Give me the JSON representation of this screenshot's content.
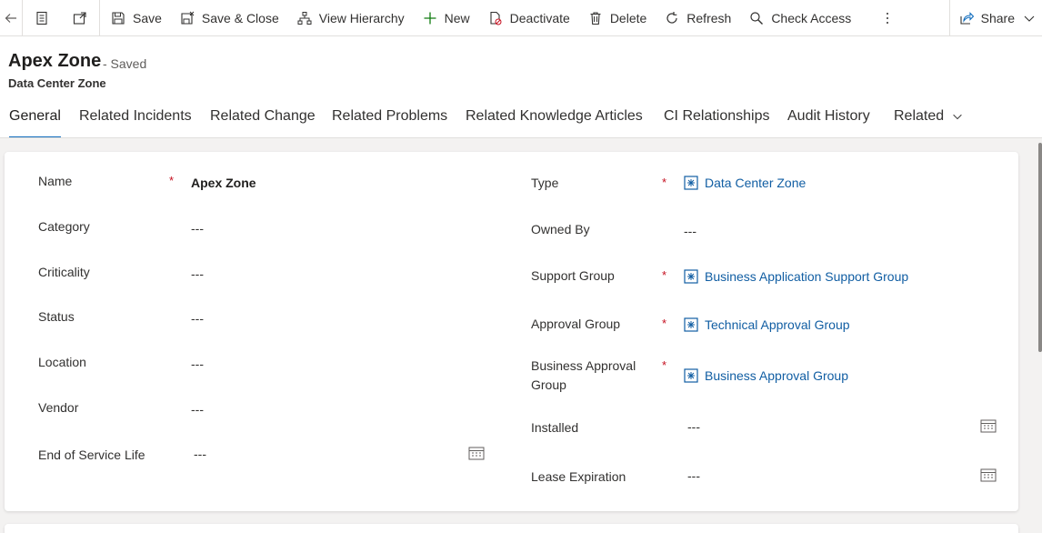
{
  "commands": {
    "save": "Save",
    "save_close": "Save & Close",
    "view_hierarchy": "View Hierarchy",
    "new": "New",
    "deactivate": "Deactivate",
    "delete": "Delete",
    "refresh": "Refresh",
    "check_access": "Check Access",
    "share": "Share"
  },
  "record": {
    "title": "Apex Zone",
    "status": "- Saved",
    "subtitle": "Data Center Zone"
  },
  "tabs": [
    {
      "label": "General",
      "active": true
    },
    {
      "label": "Related Incidents"
    },
    {
      "label": "Related Change"
    },
    {
      "label": "Related Problems"
    },
    {
      "label": "Related Knowledge Articles"
    },
    {
      "label": "CI Relationships"
    },
    {
      "label": "Audit History"
    },
    {
      "label": "Related"
    }
  ],
  "left_fields": {
    "name": {
      "label": "Name",
      "value": "Apex Zone",
      "required": "*"
    },
    "category": {
      "label": "Category",
      "value": "---"
    },
    "criticality": {
      "label": "Criticality",
      "value": "---"
    },
    "status": {
      "label": "Status",
      "value": "---"
    },
    "location": {
      "label": "Location",
      "value": "---"
    },
    "vendor": {
      "label": "Vendor",
      "value": "---"
    },
    "end_of_service_life": {
      "label": "End of Service Life",
      "value": "---"
    }
  },
  "right_fields": {
    "type": {
      "label": "Type",
      "value": "Data Center Zone",
      "required": "*"
    },
    "owned_by": {
      "label": "Owned By",
      "value": "---"
    },
    "support_group": {
      "label": "Support Group",
      "value": "Business Application Support Group",
      "required": "*"
    },
    "approval_group": {
      "label": "Approval Group",
      "value": "Technical Approval Group",
      "required": "*"
    },
    "business_approval_group": {
      "label_line1": "Business Approval",
      "label_line2": "Group",
      "value": "Business Approval Group",
      "required": "*"
    },
    "installed": {
      "label": "Installed",
      "value": "---"
    },
    "lease_expiration": {
      "label": "Lease Expiration",
      "value": "---"
    }
  },
  "colors": {
    "accent": "#0f6cbd",
    "link": "#115ea3",
    "required": "#c50f1f"
  }
}
